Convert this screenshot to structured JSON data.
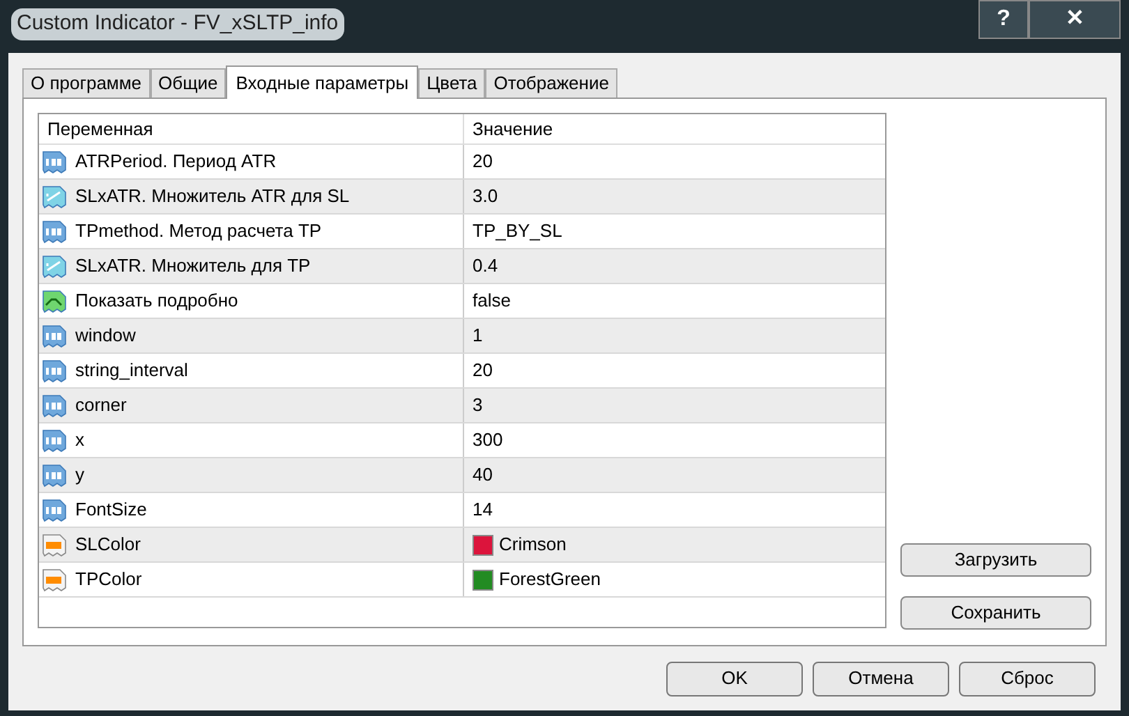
{
  "window": {
    "title": "Custom Indicator - FV_xSLTP_info",
    "help": "?",
    "close": "✕"
  },
  "tabs": [
    {
      "label": "О программе",
      "selected": false
    },
    {
      "label": "Общие",
      "selected": false
    },
    {
      "label": "Входные параметры",
      "selected": true
    },
    {
      "label": "Цвета",
      "selected": false
    },
    {
      "label": "Отображение",
      "selected": false
    }
  ],
  "table": {
    "columns": [
      "Переменная",
      "Значение"
    ],
    "rows": [
      {
        "kind": "int",
        "name": "ATRPeriod. Период ATR",
        "value": "20"
      },
      {
        "kind": "double",
        "name": "SLxATR. Множитель ATR для SL",
        "value": "3.0"
      },
      {
        "kind": "int",
        "name": "TPmethod. Метод расчета TP",
        "value": "TP_BY_SL"
      },
      {
        "kind": "double",
        "name": "SLxATR. Множитель для TP",
        "value": "0.4"
      },
      {
        "kind": "bool",
        "name": "Показать подробно",
        "value": "false"
      },
      {
        "kind": "int",
        "name": "window",
        "value": "1"
      },
      {
        "kind": "int",
        "name": "string_interval",
        "value": "20"
      },
      {
        "kind": "int",
        "name": "corner",
        "value": "3"
      },
      {
        "kind": "int",
        "name": "x",
        "value": "300"
      },
      {
        "kind": "int",
        "name": "y",
        "value": "40"
      },
      {
        "kind": "int",
        "name": "FontSize",
        "value": "14"
      },
      {
        "kind": "color",
        "name": "SLColor",
        "value": "Crimson",
        "color": "#dc143c"
      },
      {
        "kind": "color",
        "name": "TPColor",
        "value": "ForestGreen",
        "color": "#228b22"
      }
    ]
  },
  "side_buttons": [
    "Загрузить",
    "Сохранить"
  ],
  "buttons": [
    "OK",
    "Отмена",
    "Сброс"
  ]
}
